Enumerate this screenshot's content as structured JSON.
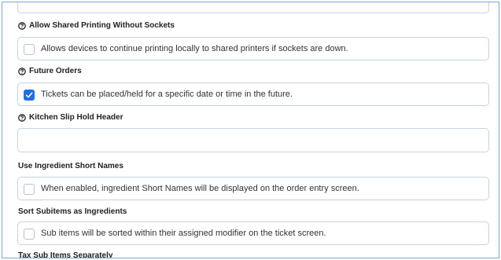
{
  "settings": [
    {
      "label": "Allow Shared Printing Without Sockets",
      "has_help_icon": true,
      "type": "checkbox",
      "checked": false,
      "description": "Allows devices to continue printing locally to shared printers if sockets are down."
    },
    {
      "label": "Future Orders",
      "has_help_icon": true,
      "type": "checkbox",
      "checked": true,
      "description": "Tickets can be placed/held for a specific date or time in the future."
    },
    {
      "label": "Kitchen Slip Hold Header",
      "has_help_icon": true,
      "type": "text",
      "value": ""
    },
    {
      "label": "Use Ingredient Short Names",
      "has_help_icon": false,
      "type": "checkbox",
      "checked": false,
      "description": "When enabled, ingredient Short Names will be displayed on the order entry screen."
    },
    {
      "label": "Sort Subitems as Ingredients",
      "has_help_icon": false,
      "type": "checkbox",
      "checked": false,
      "description": "Sub items will be sorted within their assigned modifier on the ticket screen."
    },
    {
      "label": "Tax Sub Items Separately",
      "has_help_icon": false
    }
  ],
  "colors": {
    "accent": "#1f6fe0",
    "frame_border": "#7aa6d8",
    "field_border": "#c9d2de"
  },
  "icons": {
    "help": "question-circle-icon",
    "check": "checkmark-icon"
  }
}
